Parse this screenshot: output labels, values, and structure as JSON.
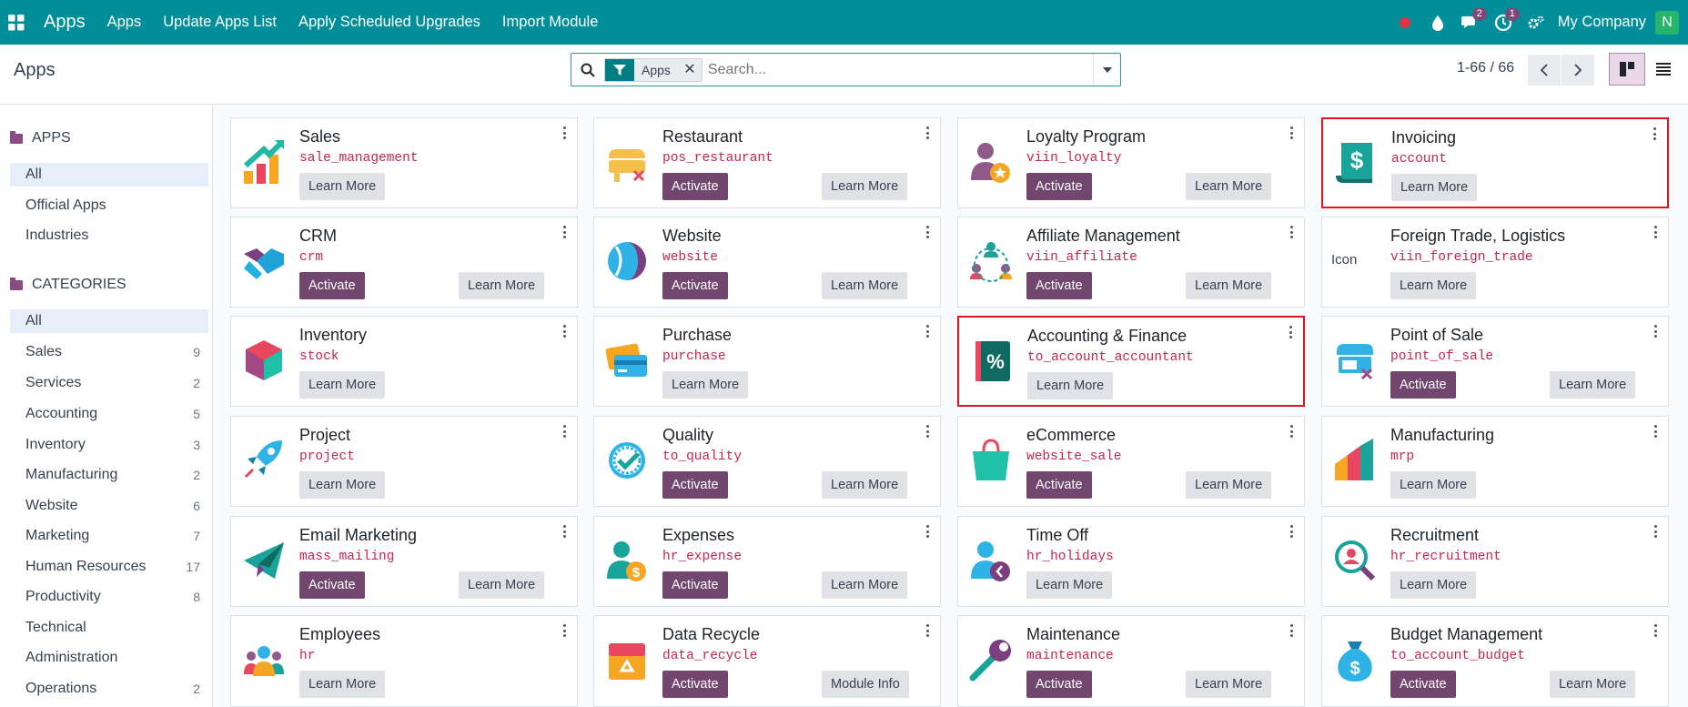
{
  "navbar": {
    "brand": "Apps",
    "menu": [
      "Apps",
      "Update Apps List",
      "Apply Scheduled Upgrades",
      "Import Module"
    ],
    "messages_badge": "2",
    "activity_badge": "1",
    "company": "My Company",
    "avatar_letter": "N"
  },
  "control": {
    "title": "Apps",
    "facet_label": "Apps",
    "search_placeholder": "Search...",
    "pager": "1-66 / 66"
  },
  "sidebar": {
    "apps_heading": "APPS",
    "apps_items": [
      "All",
      "Official Apps",
      "Industries"
    ],
    "categories_heading": "CATEGORIES",
    "categories": [
      {
        "label": "All",
        "count": ""
      },
      {
        "label": "Sales",
        "count": "9"
      },
      {
        "label": "Services",
        "count": "2"
      },
      {
        "label": "Accounting",
        "count": "5"
      },
      {
        "label": "Inventory",
        "count": "3"
      },
      {
        "label": "Manufacturing",
        "count": "2"
      },
      {
        "label": "Website",
        "count": "6"
      },
      {
        "label": "Marketing",
        "count": "7"
      },
      {
        "label": "Human Resources",
        "count": "17"
      },
      {
        "label": "Productivity",
        "count": "8"
      },
      {
        "label": "Technical",
        "count": ""
      },
      {
        "label": "Administration",
        "count": ""
      },
      {
        "label": "Operations",
        "count": "2"
      }
    ]
  },
  "apps": [
    {
      "name": "Sales",
      "tech": "sale_management",
      "activate": "",
      "learn": "Learn More",
      "icon": "sales-icon"
    },
    {
      "name": "Restaurant",
      "tech": "pos_restaurant",
      "activate": "Activate",
      "learn": "Learn More",
      "icon": "restaurant-icon"
    },
    {
      "name": "Loyalty Program",
      "tech": "viin_loyalty",
      "activate": "Activate",
      "learn": "Learn More",
      "icon": "loyalty-icon"
    },
    {
      "name": "Invoicing",
      "tech": "account",
      "activate": "",
      "learn": "Learn More",
      "icon": "invoicing-icon"
    },
    {
      "name": "CRM",
      "tech": "crm",
      "activate": "Activate",
      "learn": "Learn More",
      "icon": "crm-icon"
    },
    {
      "name": "Website",
      "tech": "website",
      "activate": "Activate",
      "learn": "Learn More",
      "icon": "website-icon"
    },
    {
      "name": "Affiliate Management",
      "tech": "viin_affiliate",
      "activate": "Activate",
      "learn": "Learn More",
      "icon": "affiliate-icon"
    },
    {
      "name": "Foreign Trade, Logistics",
      "tech": "viin_foreign_trade",
      "activate": "",
      "learn": "Learn More",
      "icon": "broken-image-icon",
      "alt": "Icon"
    },
    {
      "name": "Inventory",
      "tech": "stock",
      "activate": "",
      "learn": "Learn More",
      "icon": "inventory-icon"
    },
    {
      "name": "Purchase",
      "tech": "purchase",
      "activate": "",
      "learn": "Learn More",
      "icon": "purchase-icon"
    },
    {
      "name": "Accounting & Finance",
      "tech": "to_account_accountant",
      "activate": "",
      "learn": "Learn More",
      "icon": "accounting-icon"
    },
    {
      "name": "Point of Sale",
      "tech": "point_of_sale",
      "activate": "Activate",
      "learn": "Learn More",
      "icon": "pos-icon"
    },
    {
      "name": "Project",
      "tech": "project",
      "activate": "",
      "learn": "Learn More",
      "icon": "project-icon"
    },
    {
      "name": "Quality",
      "tech": "to_quality",
      "activate": "Activate",
      "learn": "Learn More",
      "icon": "quality-icon"
    },
    {
      "name": "eCommerce",
      "tech": "website_sale",
      "activate": "Activate",
      "learn": "Learn More",
      "icon": "ecommerce-icon"
    },
    {
      "name": "Manufacturing",
      "tech": "mrp",
      "activate": "",
      "learn": "Learn More",
      "icon": "manufacturing-icon"
    },
    {
      "name": "Email Marketing",
      "tech": "mass_mailing",
      "activate": "Activate",
      "learn": "Learn More",
      "icon": "email-marketing-icon"
    },
    {
      "name": "Expenses",
      "tech": "hr_expense",
      "activate": "Activate",
      "learn": "Learn More",
      "icon": "expenses-icon"
    },
    {
      "name": "Time Off",
      "tech": "hr_holidays",
      "activate": "",
      "learn": "Learn More",
      "icon": "time-off-icon"
    },
    {
      "name": "Recruitment",
      "tech": "hr_recruitment",
      "activate": "",
      "learn": "Learn More",
      "icon": "recruitment-icon"
    },
    {
      "name": "Employees",
      "tech": "hr",
      "activate": "",
      "learn": "Learn More",
      "icon": "employees-icon"
    },
    {
      "name": "Data Recycle",
      "tech": "data_recycle",
      "activate": "Activate",
      "learn": "Module Info",
      "icon": "data-recycle-icon"
    },
    {
      "name": "Maintenance",
      "tech": "maintenance",
      "activate": "Activate",
      "learn": "Learn More",
      "icon": "maintenance-icon"
    },
    {
      "name": "Budget Management",
      "tech": "to_account_budget",
      "activate": "Activate",
      "learn": "Learn More",
      "icon": "budget-icon"
    }
  ]
}
